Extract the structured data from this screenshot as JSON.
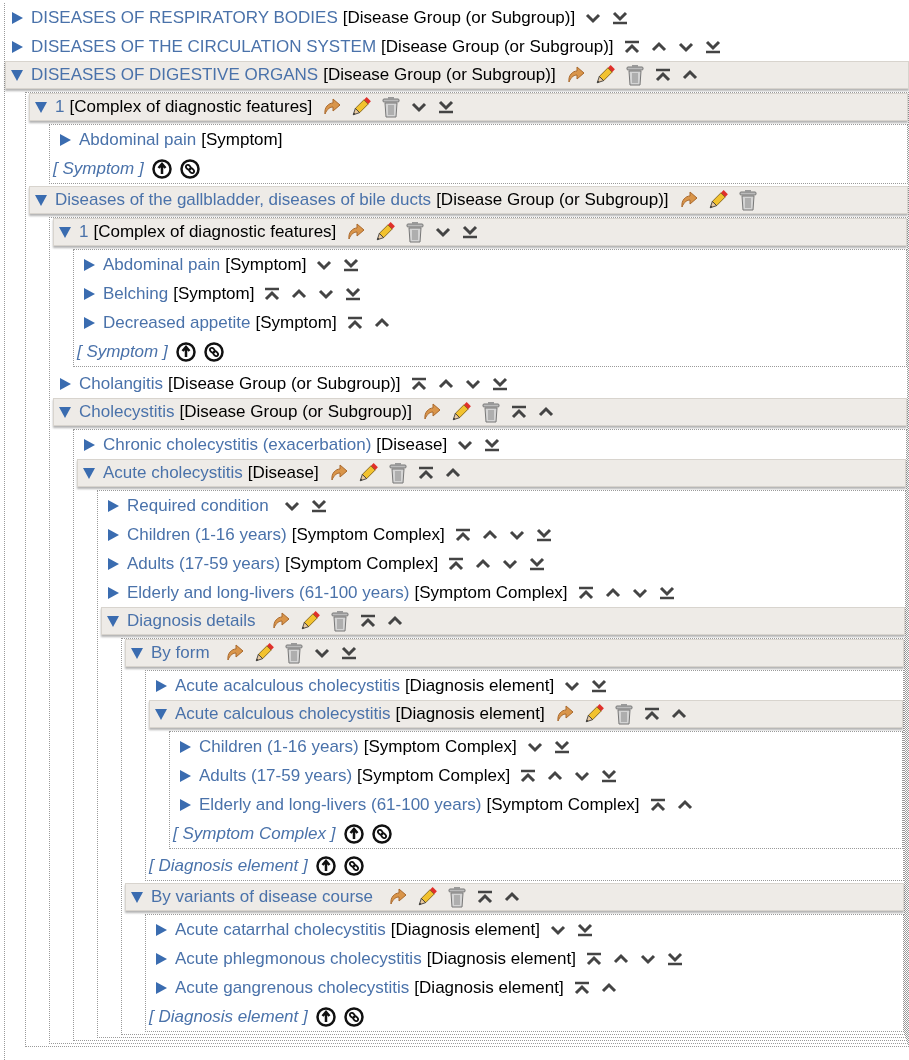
{
  "nodes": [
    {
      "label": "DISEASES OF RESPIRATORY BODIES",
      "type": "[Disease Group (or Subgroup)]",
      "expanded": false,
      "actions": [
        {
          "kind": "down"
        },
        {
          "kind": "bottom"
        }
      ]
    },
    {
      "label": "DISEASES OF THE CIRCULATION SYSTEM",
      "type": "[Disease Group (or Subgroup)]",
      "expanded": false,
      "actions": [
        {
          "kind": "top"
        },
        {
          "kind": "up"
        },
        {
          "kind": "down"
        },
        {
          "kind": "bottom"
        }
      ]
    },
    {
      "label": "DISEASES OF DIGESTIVE ORGANS",
      "type": "[Disease Group (or Subgroup)]",
      "expanded": true,
      "actions": [
        {
          "kind": "jump"
        },
        {
          "kind": "edit"
        },
        {
          "kind": "delete"
        },
        {
          "kind": "top"
        },
        {
          "kind": "up"
        }
      ],
      "children": [
        {
          "label": "1",
          "type": "[Complex of diagnostic features]",
          "expanded": true,
          "actions": [
            {
              "kind": "jump"
            },
            {
              "kind": "edit"
            },
            {
              "kind": "delete"
            },
            {
              "kind": "down"
            },
            {
              "kind": "bottom"
            }
          ],
          "children": [
            {
              "label": "Abdominal pain",
              "type": "[Symptom]",
              "expanded": false
            }
          ],
          "footer": "[ Symptom ]"
        },
        {
          "label": "Diseases of the gallbladder, diseases of bile ducts",
          "type": "[Disease Group (or Subgroup)]",
          "expanded": true,
          "actions": [
            {
              "kind": "jump"
            },
            {
              "kind": "edit"
            },
            {
              "kind": "delete"
            }
          ],
          "children": [
            {
              "label": "1",
              "type": "[Complex of diagnostic features]",
              "expanded": true,
              "actions": [
                {
                  "kind": "jump"
                },
                {
                  "kind": "edit"
                },
                {
                  "kind": "delete"
                },
                {
                  "kind": "down"
                },
                {
                  "kind": "bottom"
                }
              ],
              "children": [
                {
                  "label": "Abdominal pain",
                  "type": "[Symptom]",
                  "expanded": false,
                  "actions": [
                    {
                      "kind": "down"
                    },
                    {
                      "kind": "bottom"
                    }
                  ]
                },
                {
                  "label": "Belching",
                  "type": "[Symptom]",
                  "expanded": false,
                  "actions": [
                    {
                      "kind": "top"
                    },
                    {
                      "kind": "up"
                    },
                    {
                      "kind": "down"
                    },
                    {
                      "kind": "bottom"
                    }
                  ]
                },
                {
                  "label": "Decreased appetite",
                  "type": "[Symptom]",
                  "expanded": false,
                  "actions": [
                    {
                      "kind": "top"
                    },
                    {
                      "kind": "up"
                    }
                  ]
                }
              ],
              "footer": "[ Symptom ]"
            },
            {
              "label": "Cholangitis",
              "type": "[Disease Group (or Subgroup)]",
              "expanded": false,
              "actions": [
                {
                  "kind": "top"
                },
                {
                  "kind": "up"
                },
                {
                  "kind": "down"
                },
                {
                  "kind": "bottom"
                }
              ]
            },
            {
              "label": "Cholecystitis",
              "type": "[Disease Group (or Subgroup)]",
              "expanded": true,
              "actions": [
                {
                  "kind": "jump"
                },
                {
                  "kind": "edit"
                },
                {
                  "kind": "delete"
                },
                {
                  "kind": "top"
                },
                {
                  "kind": "up"
                }
              ],
              "children": [
                {
                  "label": "Chronic cholecystitis (exacerbation)",
                  "type": "[Disease]",
                  "expanded": false,
                  "actions": [
                    {
                      "kind": "down"
                    },
                    {
                      "kind": "bottom"
                    }
                  ]
                },
                {
                  "label": "Acute cholecystitis",
                  "type": "[Disease]",
                  "expanded": true,
                  "actions": [
                    {
                      "kind": "jump"
                    },
                    {
                      "kind": "edit"
                    },
                    {
                      "kind": "delete"
                    },
                    {
                      "kind": "top"
                    },
                    {
                      "kind": "up"
                    }
                  ],
                  "children": [
                    {
                      "label": "Required condition",
                      "expanded": false,
                      "actions": [
                        {
                          "kind": "down"
                        },
                        {
                          "kind": "bottom"
                        }
                      ]
                    },
                    {
                      "label": "Children (1-16 years)",
                      "type": "[Symptom Complex]",
                      "expanded": false,
                      "actions": [
                        {
                          "kind": "top"
                        },
                        {
                          "kind": "up"
                        },
                        {
                          "kind": "down"
                        },
                        {
                          "kind": "bottom"
                        }
                      ]
                    },
                    {
                      "label": "Adults (17-59 years)",
                      "type": "[Symptom Complex]",
                      "expanded": false,
                      "actions": [
                        {
                          "kind": "top"
                        },
                        {
                          "kind": "up"
                        },
                        {
                          "kind": "down"
                        },
                        {
                          "kind": "bottom"
                        }
                      ]
                    },
                    {
                      "label": "Elderly and long-livers  (61-100 years)",
                      "type": "[Symptom Complex]",
                      "expanded": false,
                      "actions": [
                        {
                          "kind": "top"
                        },
                        {
                          "kind": "up"
                        },
                        {
                          "kind": "down"
                        },
                        {
                          "kind": "bottom"
                        }
                      ]
                    },
                    {
                      "label": "Diagnosis details",
                      "expanded": true,
                      "actions": [
                        {
                          "kind": "jump"
                        },
                        {
                          "kind": "edit"
                        },
                        {
                          "kind": "delete"
                        },
                        {
                          "kind": "top"
                        },
                        {
                          "kind": "up"
                        }
                      ],
                      "children": [
                        {
                          "label": "By form",
                          "expanded": true,
                          "actions": [
                            {
                              "kind": "jump"
                            },
                            {
                              "kind": "edit"
                            },
                            {
                              "kind": "delete"
                            },
                            {
                              "kind": "down"
                            },
                            {
                              "kind": "bottom"
                            }
                          ],
                          "children": [
                            {
                              "label": "Acute acalculous cholecystitis",
                              "type": "[Diagnosis element]",
                              "expanded": false,
                              "actions": [
                                {
                                  "kind": "down"
                                },
                                {
                                  "kind": "bottom"
                                }
                              ]
                            },
                            {
                              "label": "Acute calculous cholecystitis",
                              "type": "[Diagnosis element]",
                              "expanded": true,
                              "actions": [
                                {
                                  "kind": "jump"
                                },
                                {
                                  "kind": "edit"
                                },
                                {
                                  "kind": "delete"
                                },
                                {
                                  "kind": "top"
                                },
                                {
                                  "kind": "up"
                                }
                              ],
                              "children": [
                                {
                                  "label": "Children (1-16 years)",
                                  "type": "[Symptom Complex]",
                                  "expanded": false,
                                  "actions": [
                                    {
                                      "kind": "down"
                                    },
                                    {
                                      "kind": "bottom"
                                    }
                                  ]
                                },
                                {
                                  "label": "Adults (17-59 years)",
                                  "type": "[Symptom Complex]",
                                  "expanded": false,
                                  "actions": [
                                    {
                                      "kind": "top"
                                    },
                                    {
                                      "kind": "up"
                                    },
                                    {
                                      "kind": "down"
                                    },
                                    {
                                      "kind": "bottom"
                                    }
                                  ]
                                },
                                {
                                  "label": "Elderly and long-livers  (61-100 years)",
                                  "type": "[Symptom Complex]",
                                  "expanded": false,
                                  "actions": [
                                    {
                                      "kind": "top"
                                    },
                                    {
                                      "kind": "up"
                                    }
                                  ]
                                }
                              ],
                              "footer": "[ Symptom Complex ]"
                            }
                          ],
                          "footer": "[ Diagnosis element ]"
                        },
                        {
                          "label": "By variants of disease course",
                          "expanded": true,
                          "actions": [
                            {
                              "kind": "jump"
                            },
                            {
                              "kind": "edit"
                            },
                            {
                              "kind": "delete"
                            },
                            {
                              "kind": "top"
                            },
                            {
                              "kind": "up"
                            }
                          ],
                          "children": [
                            {
                              "label": "Acute catarrhal cholecystitis",
                              "type": "[Diagnosis element]",
                              "expanded": false,
                              "actions": [
                                {
                                  "kind": "down"
                                },
                                {
                                  "kind": "bottom"
                                }
                              ]
                            },
                            {
                              "label": "Acute phlegmonous cholecystitis",
                              "type": "[Diagnosis element]",
                              "expanded": false,
                              "actions": [
                                {
                                  "kind": "top"
                                },
                                {
                                  "kind": "up"
                                },
                                {
                                  "kind": "down"
                                },
                                {
                                  "kind": "bottom"
                                }
                              ]
                            },
                            {
                              "label": "Acute gangrenous cholecystitis",
                              "type": "[Diagnosis element]",
                              "expanded": false,
                              "actions": [
                                {
                                  "kind": "top"
                                },
                                {
                                  "kind": "up"
                                }
                              ]
                            }
                          ],
                          "footer": "[ Diagnosis element ]"
                        }
                      ]
                    }
                  ]
                }
              ]
            }
          ]
        }
      ]
    }
  ]
}
